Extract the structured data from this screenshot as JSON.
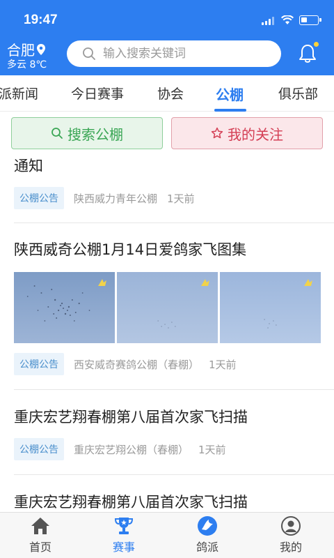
{
  "status_bar": {
    "time": "19:47"
  },
  "header": {
    "city": "合肥",
    "weather": "多云 8℃",
    "search_placeholder": "输入搜索关键词"
  },
  "tabs": [
    {
      "label": "派新闻"
    },
    {
      "label": "今日赛事"
    },
    {
      "label": "协会"
    },
    {
      "label": "公棚"
    },
    {
      "label": "俱乐部"
    }
  ],
  "active_tab": "公棚",
  "actions": {
    "search_label": "搜索公棚",
    "follow_label": "我的关注"
  },
  "feed": [
    {
      "title": "通知",
      "tag": "公棚公告",
      "source": "陕西威力青年公棚",
      "time": "1天前"
    },
    {
      "title": "陕西威奇公棚1月14日爱鸽家飞图集",
      "tag": "公棚公告",
      "source": "西安威奇赛鸽公棚（春棚）",
      "time": "1天前",
      "has_photos": true
    },
    {
      "title": "重庆宏艺翔春棚第八届首次家飞扫描",
      "tag": "公棚公告",
      "source": "重庆宏艺翔公棚（春棚）",
      "time": "1天前"
    },
    {
      "title": "重庆宏艺翔春棚第八届首次家飞扫描"
    }
  ],
  "bottom_nav": [
    {
      "label": "首页",
      "icon": "home-icon"
    },
    {
      "label": "赛事",
      "icon": "trophy-icon"
    },
    {
      "label": "鸽派",
      "icon": "pigeon-icon"
    },
    {
      "label": "我的",
      "icon": "user-icon"
    }
  ],
  "colors": {
    "primary": "#2d7ef0",
    "search_green": "#3aa655",
    "follow_red": "#d43f55"
  }
}
